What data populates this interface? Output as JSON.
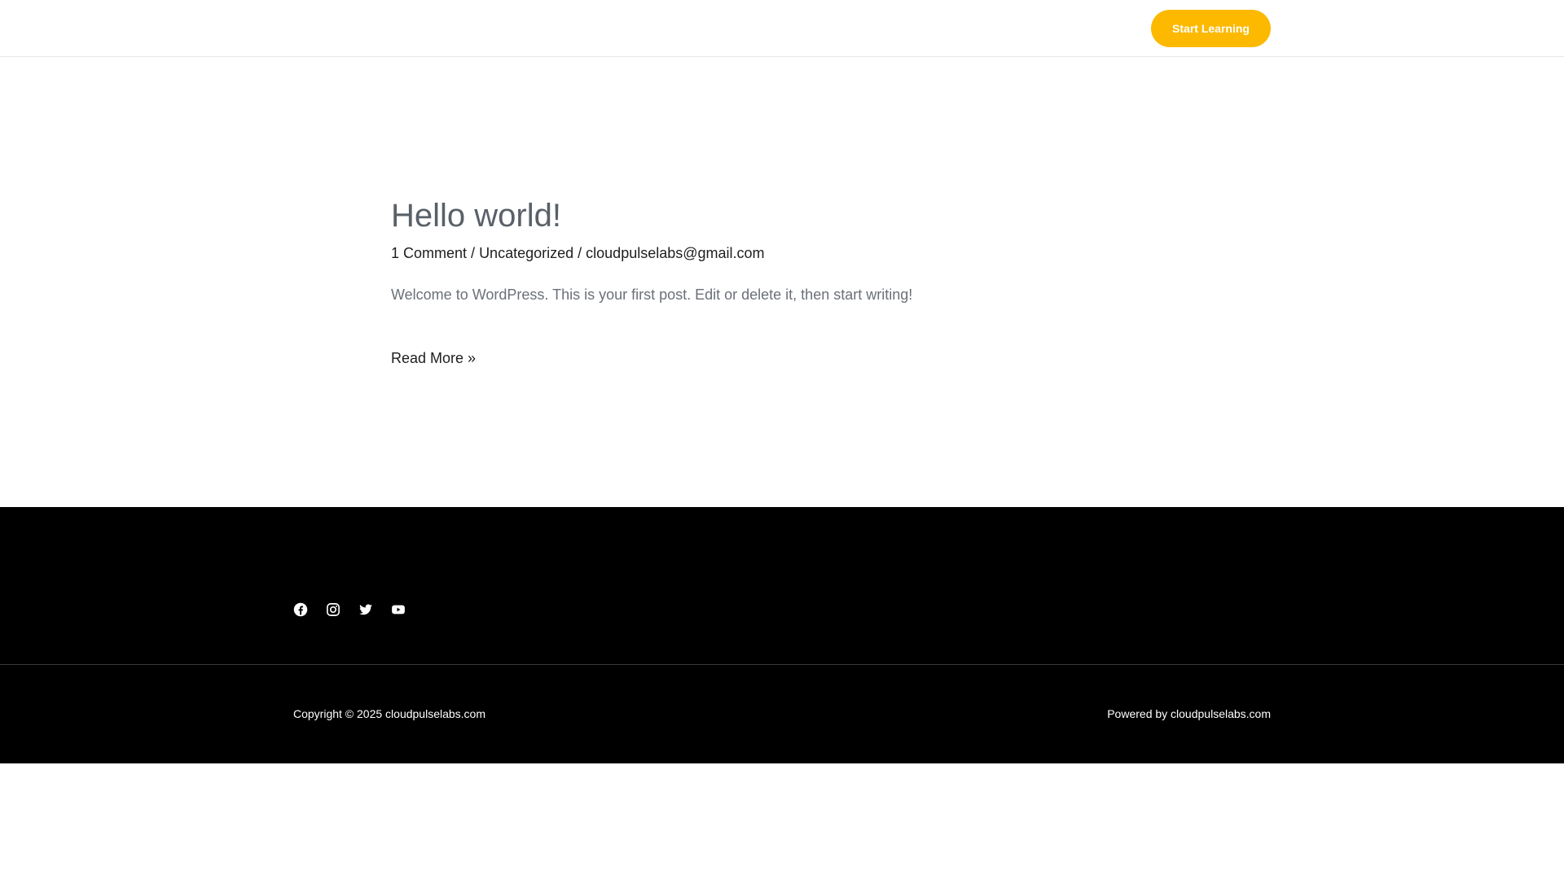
{
  "header": {
    "cta_label": "Start Learning"
  },
  "post": {
    "title": "Hello world!",
    "meta": {
      "comments": "1 Comment",
      "separator": " / ",
      "category": "Uncategorized",
      "author": "cloudpulselabs@gmail.com"
    },
    "excerpt": "Welcome to WordPress. This is your first post. Edit or delete it, then start writing!",
    "read_more": "Read More »"
  },
  "footer": {
    "social": [
      {
        "icon": "facebook-icon"
      },
      {
        "icon": "instagram-icon"
      },
      {
        "icon": "twitter-icon"
      },
      {
        "icon": "youtube-icon"
      }
    ],
    "copyright": "Copyright © 2025 cloudpulselabs.com",
    "powered_by": "Powered by cloudpulselabs.com"
  },
  "colors": {
    "accent": "#fcb900",
    "footer_bg": "#000000",
    "title": "#5a6068"
  }
}
